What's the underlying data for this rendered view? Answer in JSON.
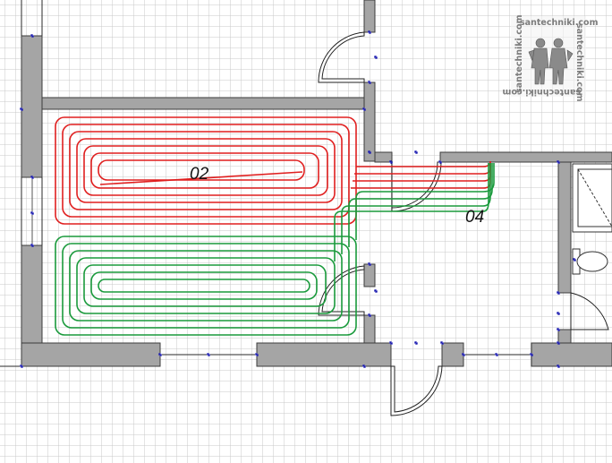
{
  "plan": {
    "background": "#ffffff",
    "grid_color": "#c9c9c9",
    "wall_fill": "#a5a5a5",
    "wall_stroke": "#3c3c3c",
    "node_color": "#1b1bb0"
  },
  "loops": [
    {
      "label": "02",
      "color": "#e01f1f",
      "description": "floor heating loop, upper room area"
    },
    {
      "label": "04",
      "color": "#1a9a3c",
      "description": "floor heating loop, lower room area"
    }
  ],
  "watermark": {
    "text": "santechniki.com",
    "color": "#7c7c7c",
    "icon": "two-plumbers-logo"
  }
}
